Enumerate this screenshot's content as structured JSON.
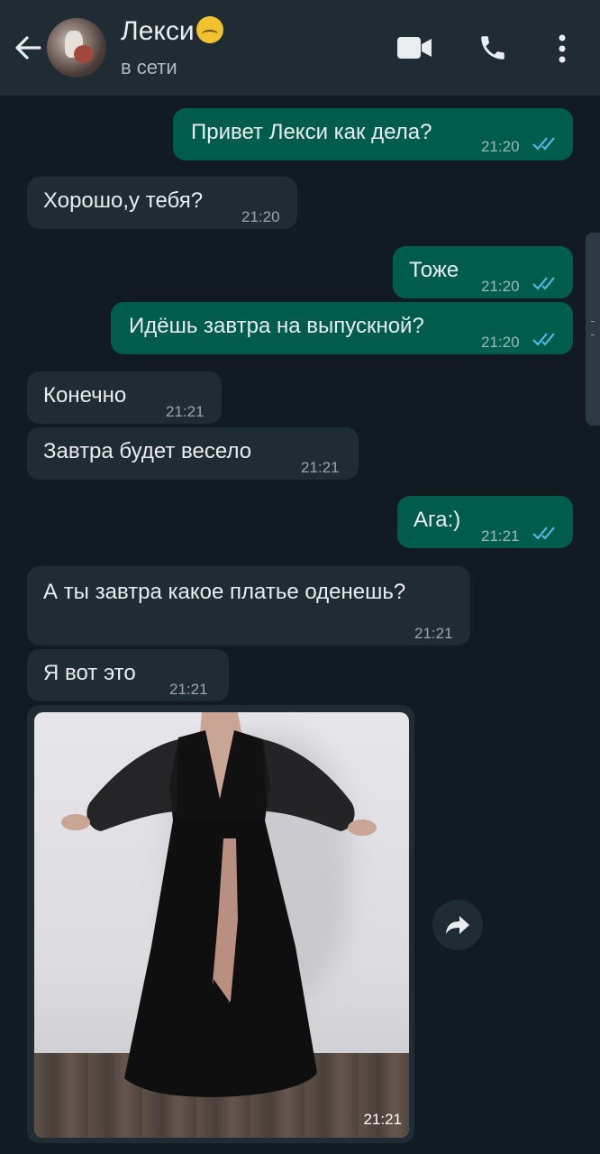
{
  "header": {
    "contact_name": "Лекси",
    "status": "в сети"
  },
  "messages": [
    {
      "direction": "outgoing",
      "text": "Привет Лекси как дела?",
      "time": "21:20",
      "read": true
    },
    {
      "direction": "incoming",
      "text": "Хорошо,у тебя?",
      "time": "21:20"
    },
    {
      "direction": "outgoing",
      "text": "Тоже",
      "time": "21:20",
      "read": true
    },
    {
      "direction": "outgoing",
      "text": "Идёшь завтра на выпускной?",
      "time": "21:20",
      "read": true
    },
    {
      "direction": "incoming",
      "text": "Конечно",
      "time": "21:21"
    },
    {
      "direction": "incoming",
      "text": "Завтра будет весело",
      "time": "21:21"
    },
    {
      "direction": "outgoing",
      "text": "Ага:)",
      "time": "21:21",
      "read": true
    },
    {
      "direction": "incoming",
      "text": "А ты завтра какое платье оденешь?",
      "time": "21:21"
    },
    {
      "direction": "incoming",
      "text": "Я вот это",
      "time": "21:21"
    },
    {
      "direction": "incoming",
      "type": "image",
      "time": "21:21"
    }
  ],
  "colors": {
    "background": "#121b22",
    "header": "#1f2c34",
    "outgoing_bubble": "#005c4b",
    "incoming_bubble": "#1f2c34",
    "read_ticks": "#53bdeb"
  }
}
